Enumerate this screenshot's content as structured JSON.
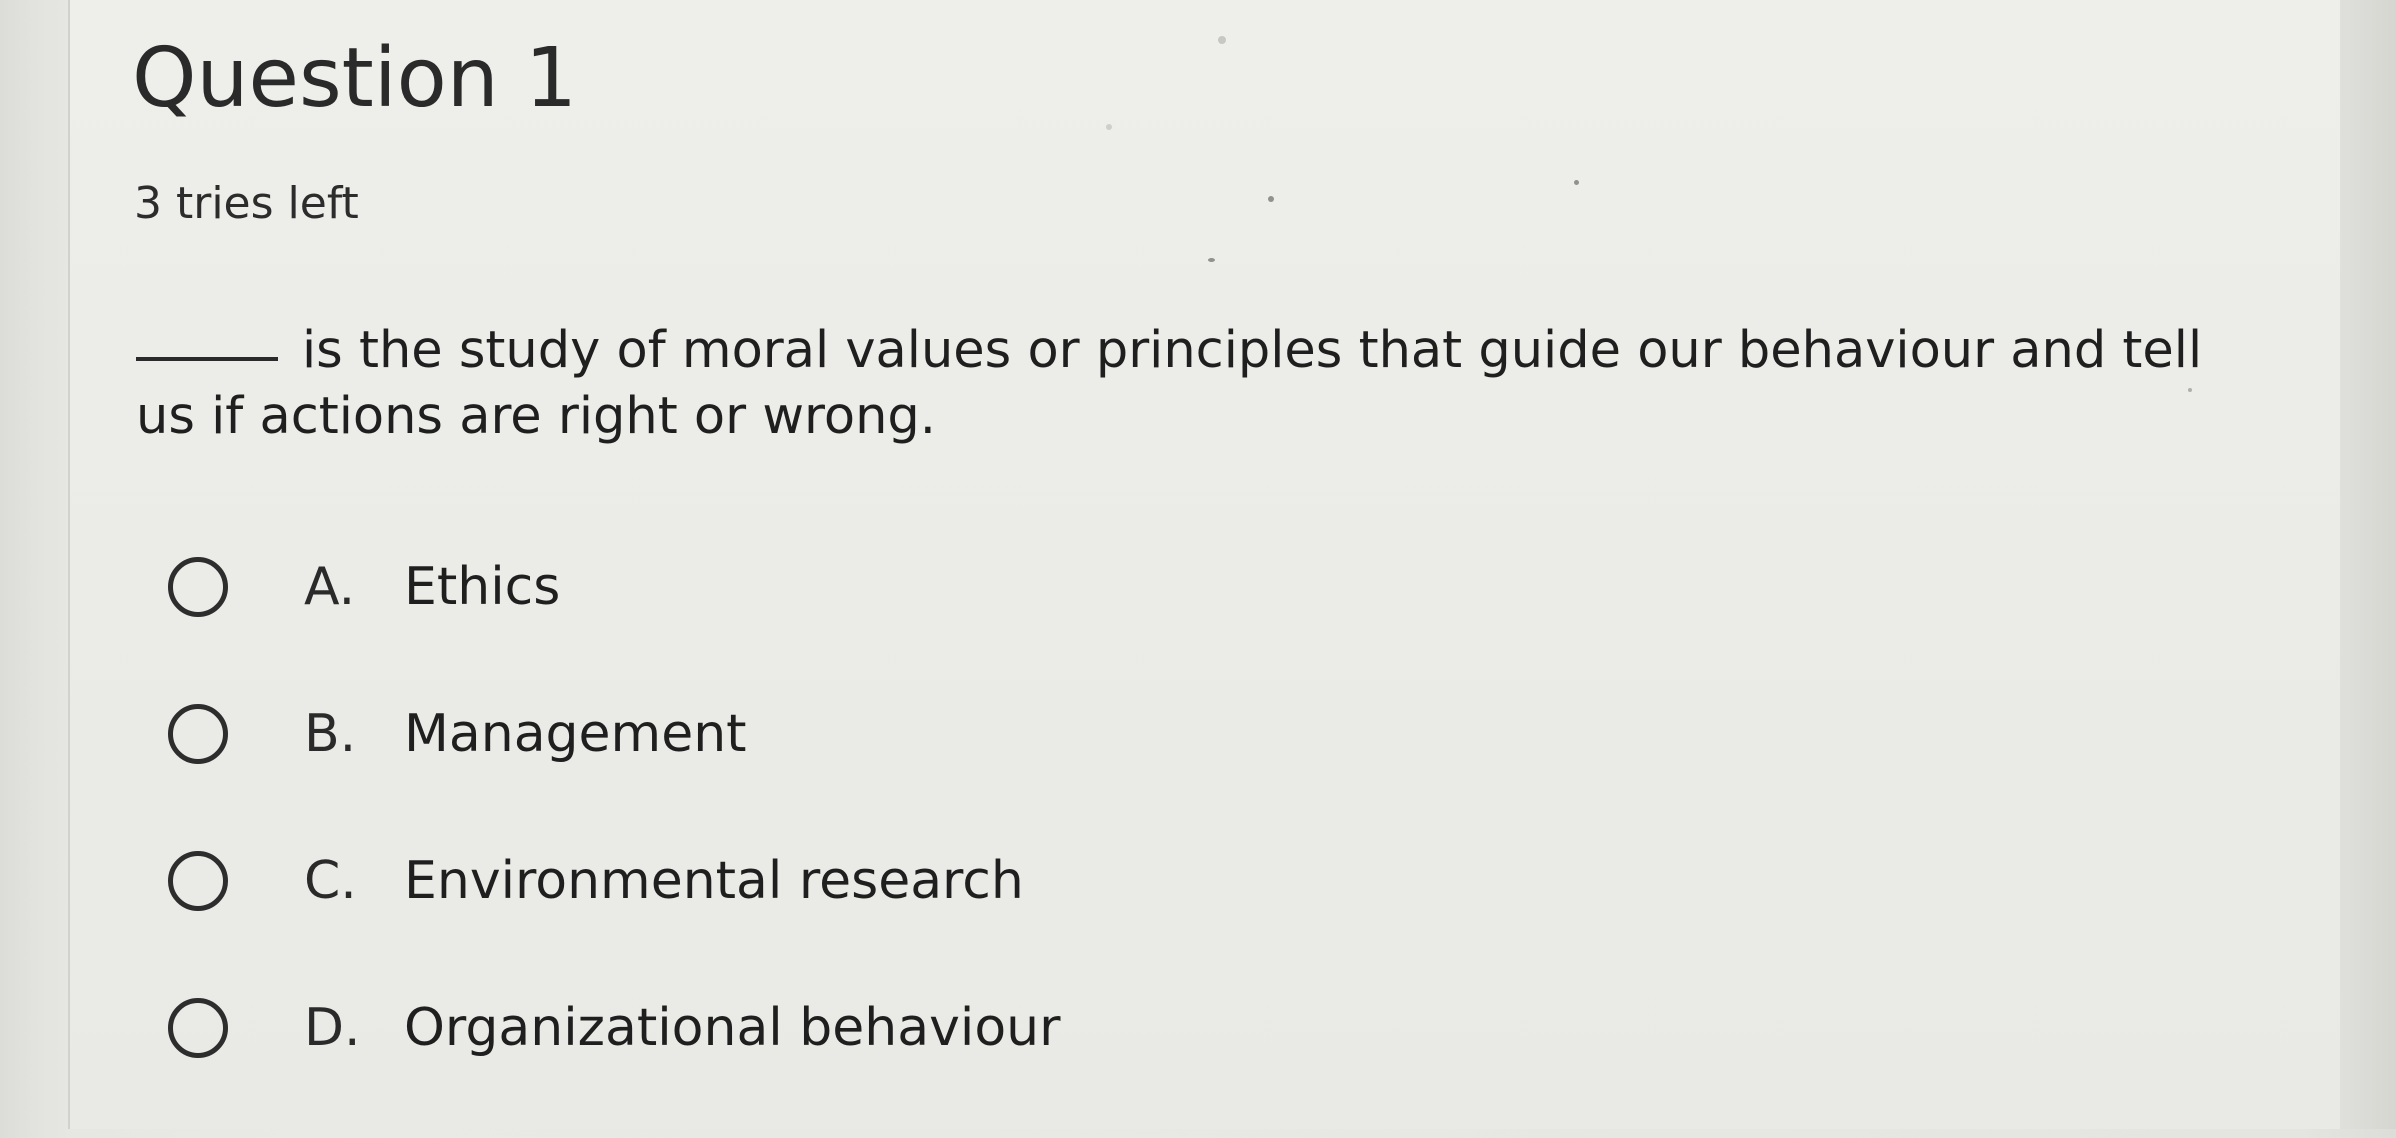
{
  "question": {
    "title": "Question 1",
    "tries_left": "3 tries left",
    "text": "is the study of moral values or principles that guide our behaviour and tell us if actions are right or wrong."
  },
  "options": [
    {
      "letter": "A.",
      "label": "Ethics"
    },
    {
      "letter": "B.",
      "label": "Management"
    },
    {
      "letter": "C.",
      "label": "Environmental research"
    },
    {
      "letter": "D.",
      "label": "Organizational behaviour"
    }
  ]
}
